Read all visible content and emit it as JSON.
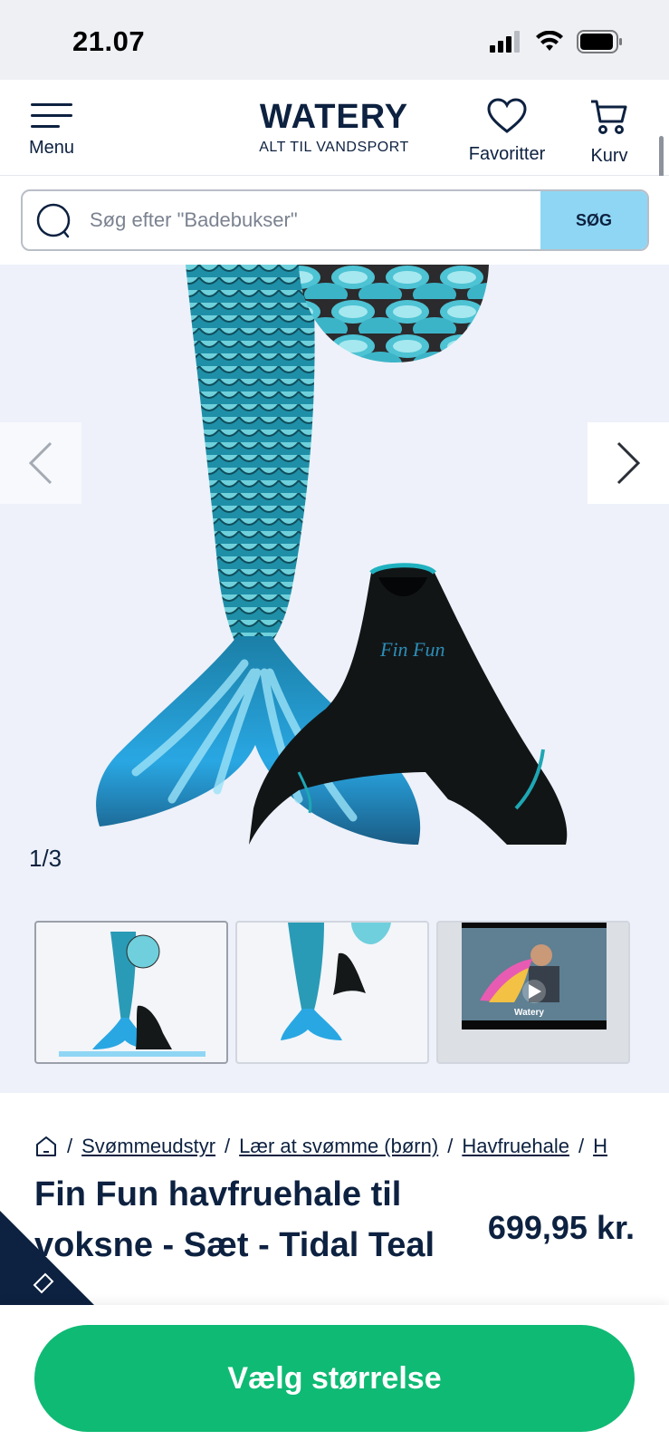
{
  "status_bar": {
    "time": "21.07"
  },
  "header": {
    "menu_label": "Menu",
    "logo_main": "WATERY",
    "logo_sub": "ALT TIL VANDSPORT",
    "favorites_label": "Favoritter",
    "cart_label": "Kurv"
  },
  "search": {
    "placeholder": "Søg efter \"Badebukser\"",
    "button_label": "SØG"
  },
  "gallery": {
    "counter": "1/3",
    "current_index": 1,
    "total": 3,
    "thumbnails": [
      "image-1",
      "image-2",
      "video"
    ],
    "video_thumb_text": "Watery"
  },
  "breadcrumb": {
    "items": [
      "Svømmeudstyr",
      "Lær at svømme (børn)",
      "Havfruehale",
      "H"
    ]
  },
  "product": {
    "title_line1": "Fin Fun havfruehale til",
    "title_line2": "voksne - Sæt - Tidal Teal",
    "price": "699,95 kr."
  },
  "footer": {
    "cta_label": "Vælg størrelse"
  },
  "colors": {
    "brand_navy": "#0d2140",
    "accent_light_blue": "#8fd6f4",
    "cta_green": "#0fba74",
    "gallery_bg": "#eef1f9"
  }
}
